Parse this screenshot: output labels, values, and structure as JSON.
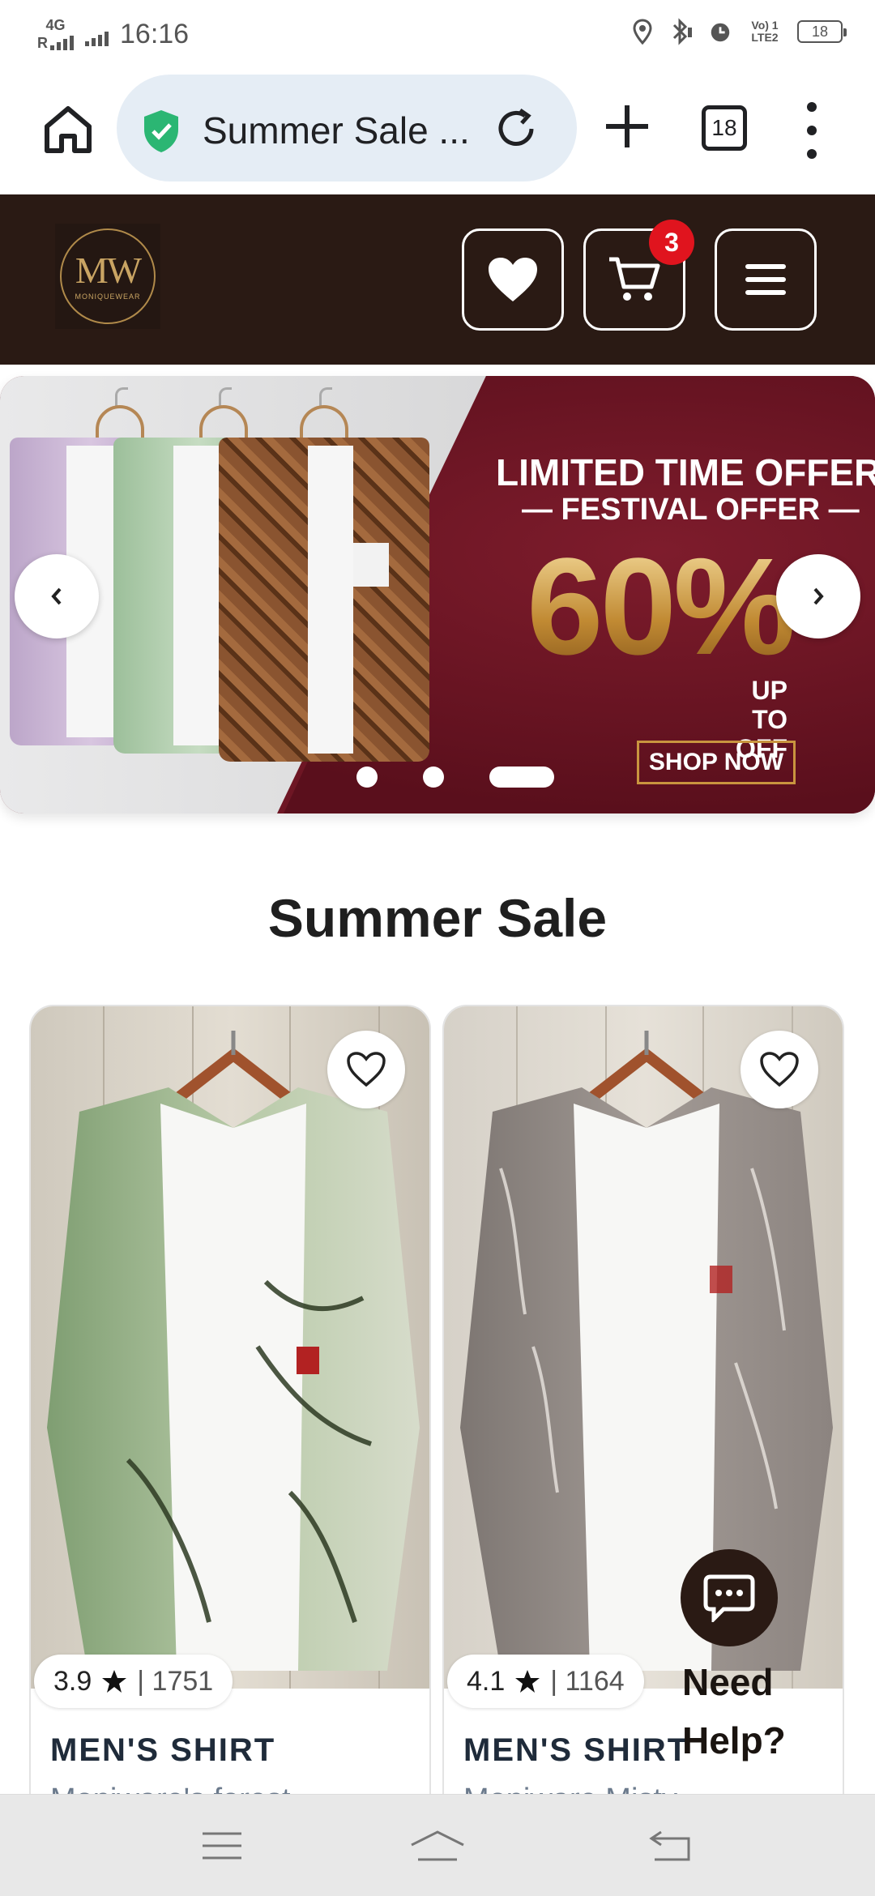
{
  "status_bar": {
    "network": "4G",
    "roaming": "R",
    "time": "16:16",
    "volte": "Vo) 1",
    "lte": "LTE2",
    "battery": "18"
  },
  "browser": {
    "url_title": "Summer Sale ...",
    "tab_count": "18",
    "secure_color": "#2bb673"
  },
  "site_header": {
    "logo_mark": "MW",
    "logo_name": "MONIQUEWEAR",
    "cart_count": "3",
    "bg_color": "#2a1a14"
  },
  "banner": {
    "line1": "LIMITED TIME OFFER!",
    "line2": "— FESTIVAL OFFER —",
    "discount": "60%",
    "upto_line1": "UP TO",
    "upto_line2": "OFF",
    "cta": "SHOP NOW",
    "prev_label": "‹",
    "next_label": "›",
    "slides_total": 3,
    "active_slide": 3
  },
  "section": {
    "title": "Summer Sale"
  },
  "products": [
    {
      "rating": "3.9",
      "reviews": "| 1751",
      "title": "MEN'S SHIRT",
      "subtitle": "Moniware's forest"
    },
    {
      "rating": "4.1",
      "reviews": "| 1164",
      "title": "MEN'S SHIRT",
      "subtitle": "Moniware Misty"
    }
  ],
  "chat": {
    "label_line1": "Need",
    "label_line2": "Help?"
  },
  "nav_bar": {
    "icons": [
      "menu-icon",
      "home-icon",
      "back-icon"
    ]
  }
}
